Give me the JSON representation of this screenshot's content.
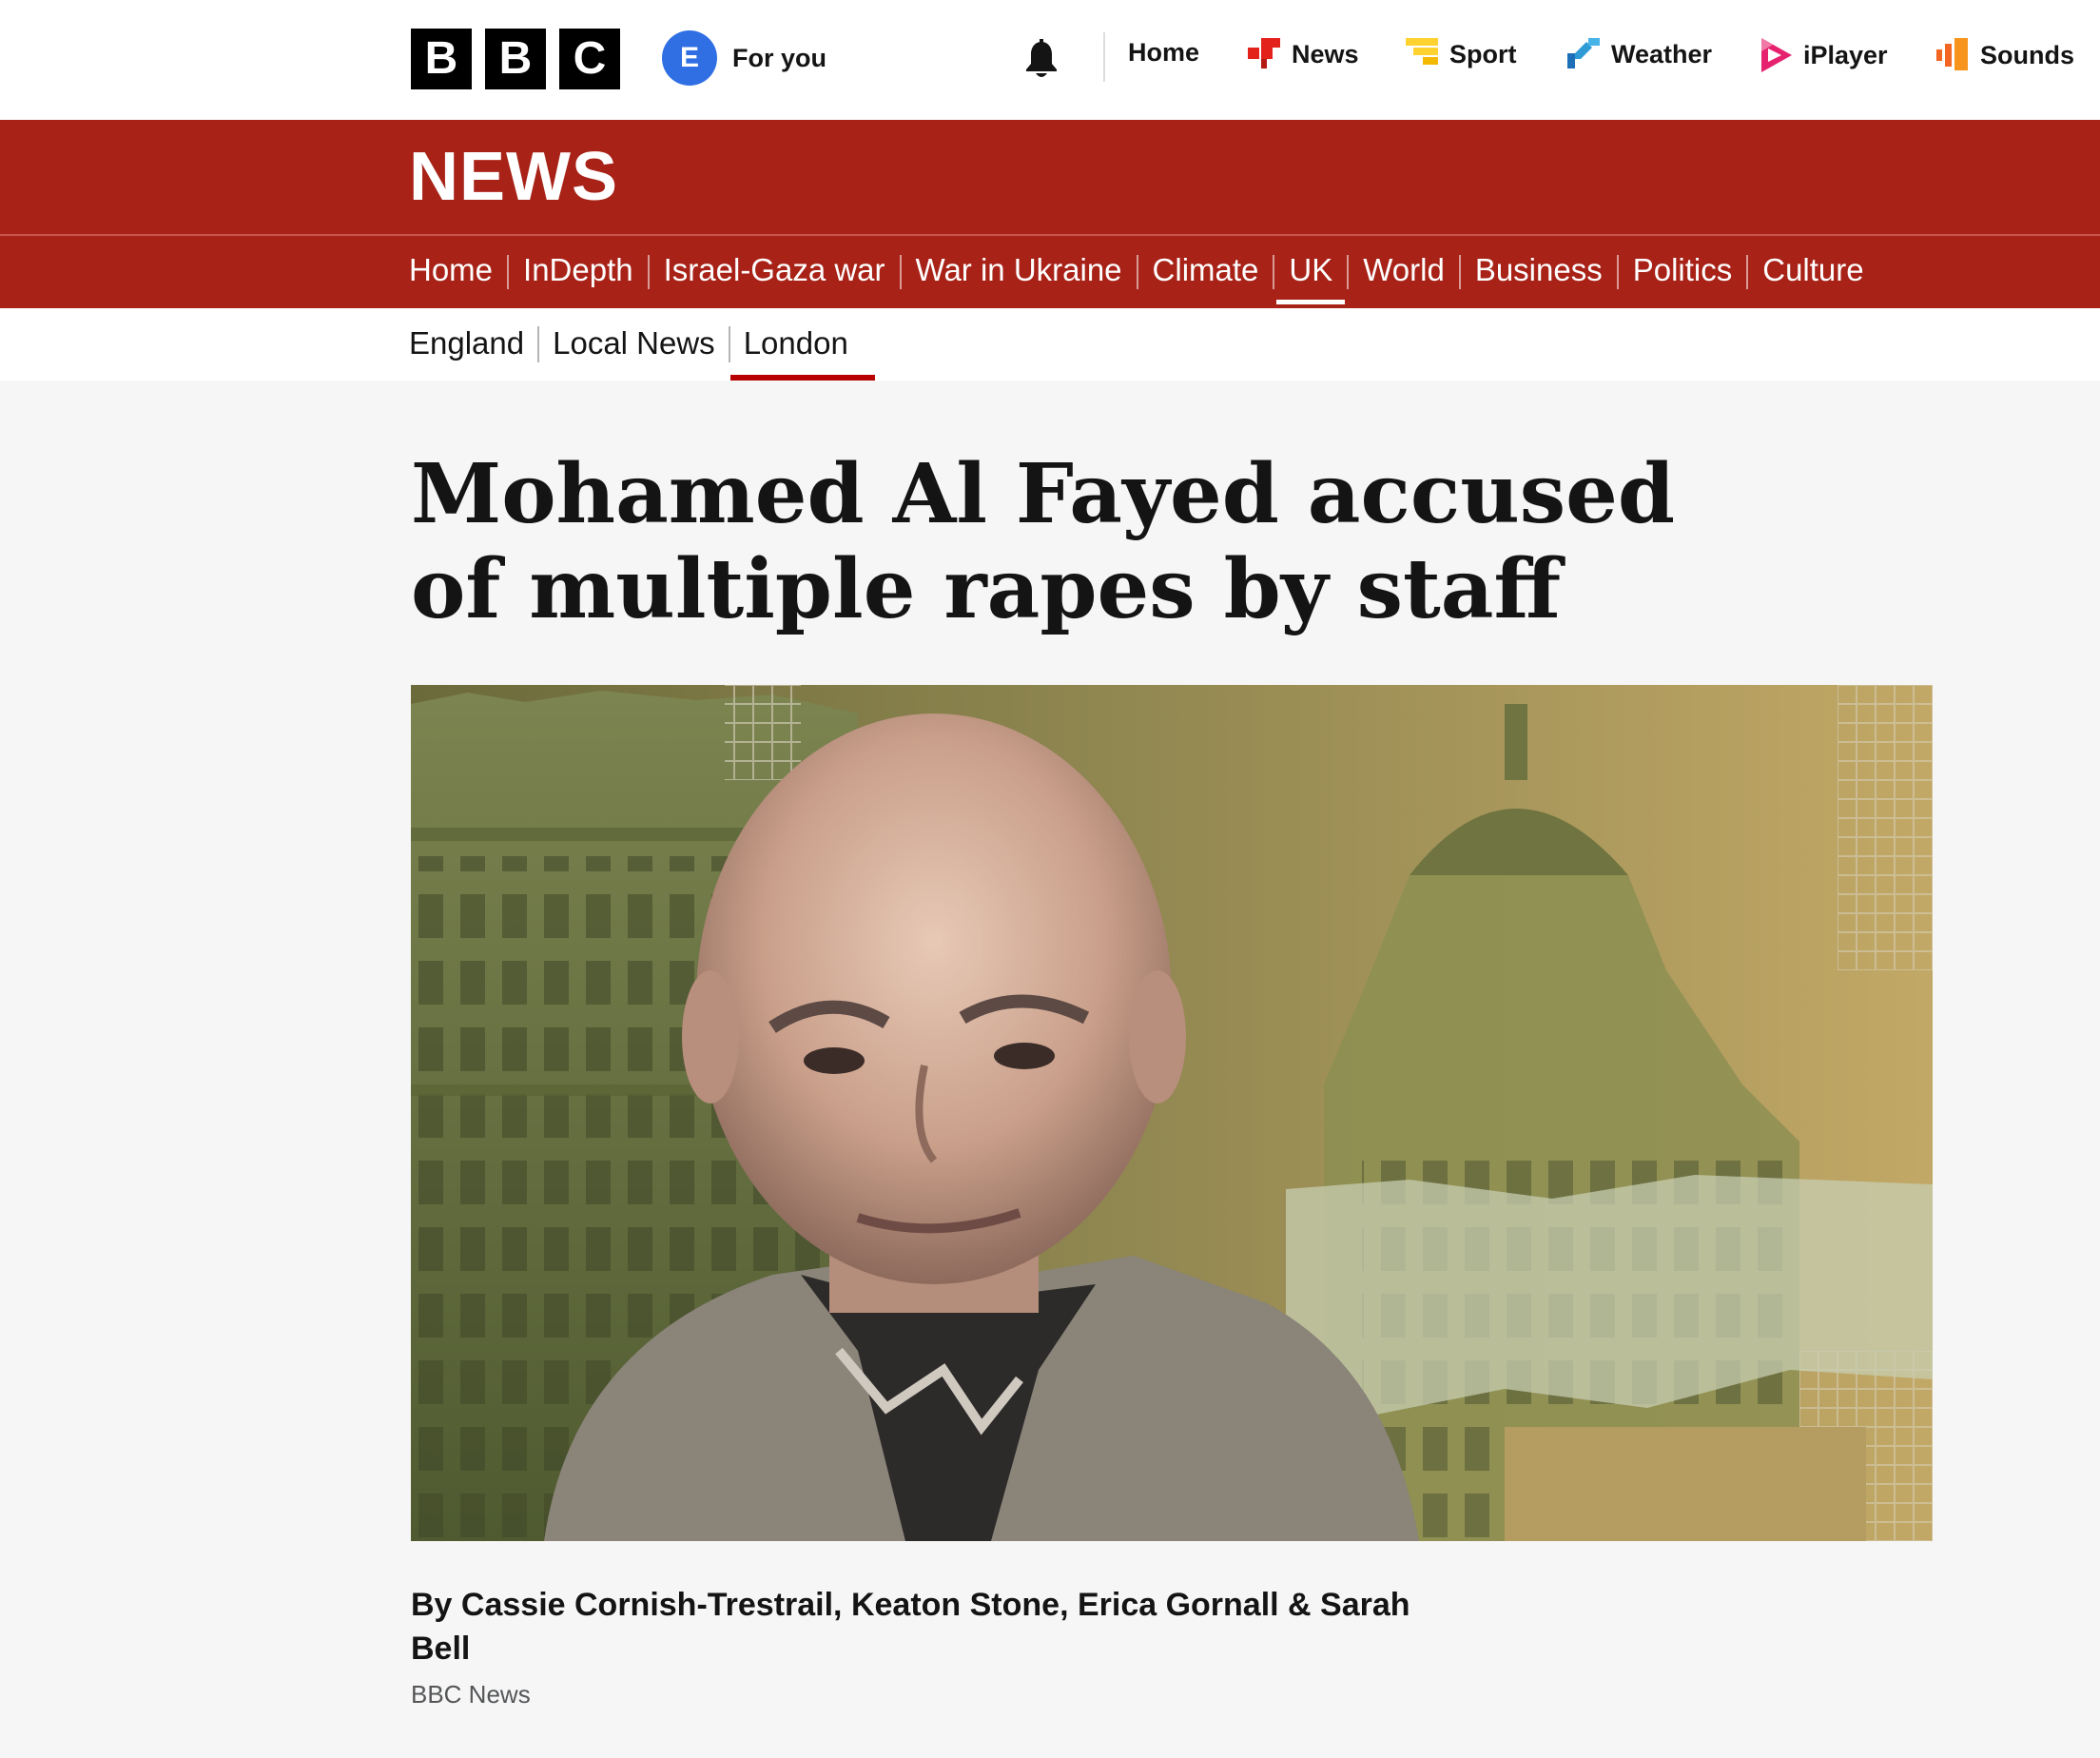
{
  "header": {
    "logo_letters": [
      "B",
      "B",
      "C"
    ],
    "account_initial": "E",
    "account_label": "For you",
    "nav": [
      {
        "label": "Home",
        "icon": "none"
      },
      {
        "label": "News",
        "icon": "news-icon",
        "color": "#e3231b"
      },
      {
        "label": "Sport",
        "icon": "sport-icon",
        "color": "#ffd230"
      },
      {
        "label": "Weather",
        "icon": "weather-icon",
        "color": "#1d70b8"
      },
      {
        "label": "iPlayer",
        "icon": "iplayer-icon",
        "color": "#e6226f"
      },
      {
        "label": "Sounds",
        "icon": "sounds-icon",
        "color": "#f26522"
      }
    ]
  },
  "news_band": {
    "title": "NEWS",
    "color": "#a82217"
  },
  "section_nav": {
    "items": [
      "Home",
      "InDepth",
      "Israel-Gaza war",
      "War in Ukraine",
      "Climate",
      "UK",
      "World",
      "Business",
      "Politics",
      "Culture"
    ],
    "active": "UK"
  },
  "sub_nav": {
    "items": [
      "England",
      "Local News",
      "London"
    ],
    "active": "London"
  },
  "article": {
    "headline": "Mohamed Al Fayed accused of multiple rapes by staff",
    "hero_description_icon": "portrait-image",
    "byline": "By Cassie Cornish-Trestrail, Keaton Stone, Erica Gornall & Sarah Bell",
    "source": "BBC News"
  }
}
